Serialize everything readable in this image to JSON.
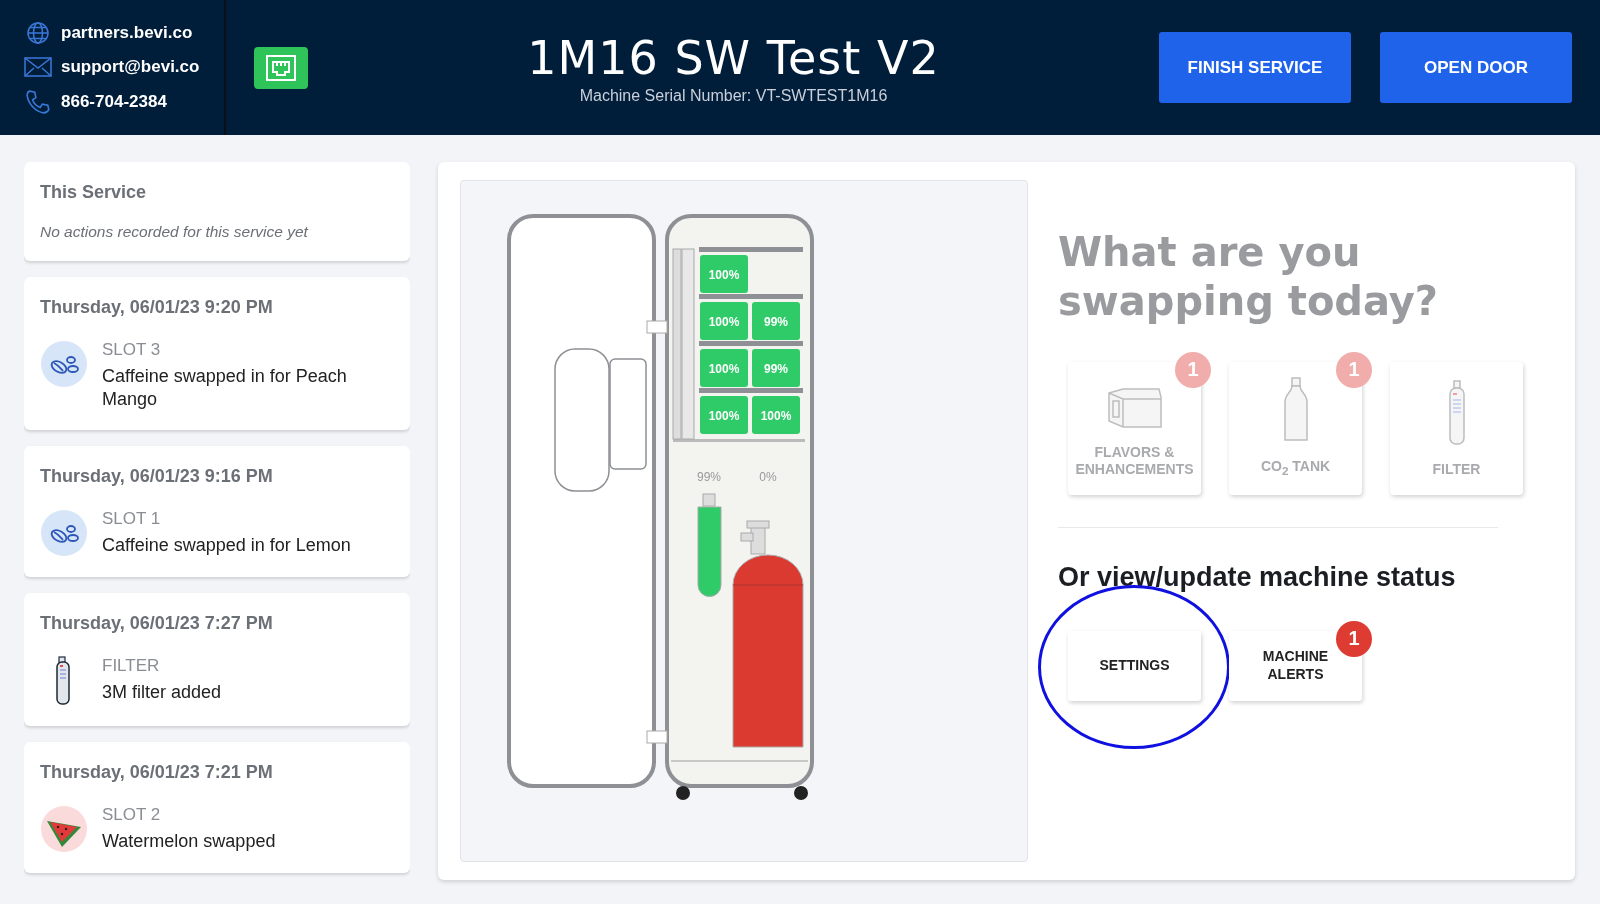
{
  "header": {
    "contacts": [
      {
        "kind": "web",
        "text": "partners.bevi.co"
      },
      {
        "kind": "mail",
        "text": "support@bevi.co"
      },
      {
        "kind": "phone",
        "text": "866-704-2384"
      }
    ],
    "title": "1M16 SW Test V2",
    "serial": "Machine Serial Number: VT-SWTEST1M16",
    "buttons": [
      "FINISH SERVICE",
      "OPEN DOOR"
    ]
  },
  "history": [
    {
      "kind": "current",
      "title": "This Service",
      "note": "No actions recorded for this service yet"
    },
    {
      "kind": "caffeine",
      "title": "Thursday, 06/01/23 9:20 PM",
      "slot": "SLOT 3",
      "text": "Caffeine swapped in for Peach Mango"
    },
    {
      "kind": "caffeine",
      "title": "Thursday, 06/01/23 9:16 PM",
      "slot": "SLOT 1",
      "text": "Caffeine swapped in for Lemon"
    },
    {
      "kind": "filter",
      "title": "Thursday, 06/01/23 7:27 PM",
      "slot": "FILTER",
      "text": "3M filter added"
    },
    {
      "kind": "watermelon",
      "title": "Thursday, 06/01/23 7:21 PM",
      "slot": "SLOT 2",
      "text": "Watermelon swapped"
    }
  ],
  "machine": {
    "pods": [
      [
        "100%"
      ],
      [
        "100%",
        "99%"
      ],
      [
        "100%",
        "99%"
      ],
      [
        "100%",
        "100%"
      ]
    ],
    "supplies": [
      {
        "kind": "filter",
        "reading": "99%",
        "color": "#2ecb68"
      },
      {
        "kind": "co2",
        "reading": "0%",
        "color": "#db3a30"
      }
    ]
  },
  "swap": {
    "heading": "What are you swapping today?",
    "tiles": [
      {
        "kind": "flavors",
        "label": "FLAVORS & ENHANCEMENTS",
        "badge": "1",
        "disabled": true
      },
      {
        "kind": "co2",
        "label": "CO$_{2}$ TANK",
        "badge": "1",
        "disabled": true
      },
      {
        "kind": "filter",
        "label": "FILTER",
        "disabled": true
      }
    ]
  },
  "status": {
    "heading": "Or view/update machine status",
    "buttons": [
      {
        "label": "SETTINGS",
        "circled": true
      },
      {
        "label": "MACHINE ALERTS",
        "badge": "1",
        "circled": false
      }
    ]
  }
}
